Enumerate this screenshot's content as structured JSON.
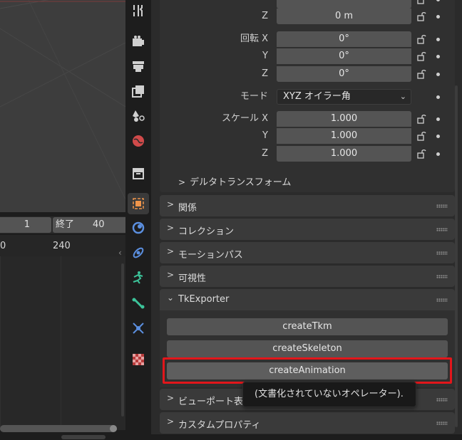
{
  "timeline": {
    "start_frame": "1",
    "end_label": "終了",
    "end_frame": "40",
    "ruler_left": "0",
    "ruler_mark": "240"
  },
  "tabs": [
    {
      "name": "tool-icon",
      "active": false
    },
    {
      "name": "render-icon",
      "active": false
    },
    {
      "name": "output-icon",
      "active": false
    },
    {
      "name": "view-layer-icon",
      "active": false
    },
    {
      "name": "scene-icon",
      "active": false
    },
    {
      "name": "world-icon",
      "active": false
    },
    {
      "name": "collection-icon",
      "active": false
    },
    {
      "name": "object-icon",
      "active": true
    },
    {
      "name": "modifier-icon",
      "active": false
    },
    {
      "name": "particles-icon",
      "active": false
    },
    {
      "name": "physics-icon",
      "active": false
    },
    {
      "name": "constraints-icon",
      "active": false
    },
    {
      "name": "object-data-icon",
      "active": false
    },
    {
      "name": "texture-icon",
      "active": false
    }
  ],
  "transform": {
    "location_z_label": "Z",
    "location_z": "0 m",
    "rotation_label": "回転 X",
    "rotation_y_label": "Y",
    "rotation_z_label": "Z",
    "rotation_x": "0°",
    "rotation_y": "0°",
    "rotation_z": "0°",
    "mode_label": "モード",
    "mode_value": "XYZ オイラー角",
    "scale_label": "スケール X",
    "scale_y_label": "Y",
    "scale_z_label": "Z",
    "scale_x": "1.000",
    "scale_y": "1.000",
    "scale_z": "1.000",
    "delta_label": "デルタトランスフォーム"
  },
  "panels": {
    "relations": "関係",
    "collections": "コレクション",
    "motion_paths": "モーションパス",
    "visibility": "可視性",
    "tkexporter": "TkExporter",
    "viewport_display": "ビューポート表",
    "custom_props": "カスタムプロパティ"
  },
  "operators": {
    "create_tkm": "createTkm",
    "create_skeleton": "createSkeleton",
    "create_animation": "createAnimation"
  },
  "tooltip": "(文書化されていないオペレーター)."
}
